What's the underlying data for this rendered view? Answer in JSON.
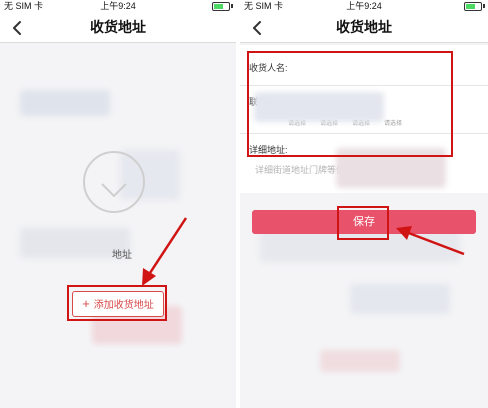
{
  "status_bar": {
    "carrier": "无 SIM 卡",
    "time": "上午9:24"
  },
  "left": {
    "title": "收货地址",
    "empty_caption": "地址",
    "add_button_label": "添加收货地址"
  },
  "right": {
    "title": "收货地址",
    "form": {
      "name_label": "收货人名:",
      "phone_label": "联系",
      "region_slots": [
        "请选择",
        "请选择",
        "请选择",
        "请选择"
      ],
      "detail_label": "详细地址:",
      "detail_placeholder": "详细街道地址门牌等信息"
    },
    "save_button_label": "保存"
  },
  "colors": {
    "accent": "#e8526a",
    "annotation": "#d01414"
  }
}
